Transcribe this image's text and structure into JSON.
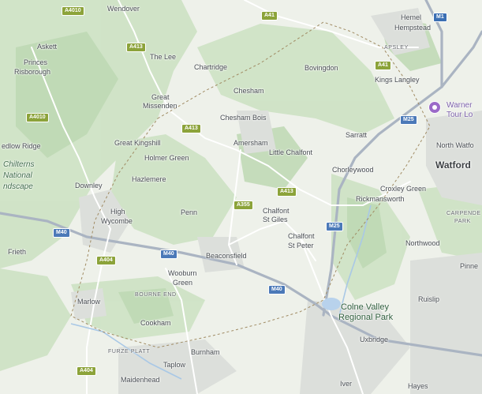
{
  "map": {
    "places": {
      "wendover": "Wendover",
      "hemel": "Hemel",
      "hempstead": "Hempstead",
      "apsley": "APSLEY",
      "askett": "Askett",
      "princes": "Princes",
      "risborough": "Risborough",
      "the_lee": "The Lee",
      "chartridge": "Chartridge",
      "bovingdon": "Bovingdon",
      "kings_langley": "Kings Langley",
      "warner_1": "Warner",
      "warner_2": "Tour Lo",
      "great": "Great",
      "missenden": "Missenden",
      "chesham": "Chesham",
      "sarratt": "Sarratt",
      "north_watford": "North Watfo",
      "edlow_ridge": "edlow Ridge",
      "chesham_bois": "Chesham Bois",
      "great_kingshill": "Great Kingshill",
      "amersham": "Amersham",
      "little_chalfont": "Little Chalfont",
      "watford": "Watford",
      "holmer_green": "Holmer Green",
      "chorleywood": "Chorleywood",
      "chilterns_1": "Chilterns",
      "chilterns_2": "National",
      "chilterns_3": "ndscape",
      "hazlemere": "Hazlemere",
      "downley": "Downley",
      "croxley_green": "Croxley Green",
      "rickmansworth": "Rickmansworth",
      "high": "High",
      "wycombe": "Wycombe",
      "penn": "Penn",
      "chalfont_sg_1": "Chalfont",
      "chalfont_sg_2": "St Giles",
      "carpenders_1": "CARPENDE",
      "carpenders_2": "PARK",
      "chalfont_sp_1": "Chalfont",
      "chalfont_sp_2": "St Peter",
      "frieth": "Frieth",
      "northwood": "Northwood",
      "beaconsfield": "Beaconsfield",
      "pinner": "Pinne",
      "wooburn": "Wooburn",
      "green": "Green",
      "marlow": "Marlow",
      "bourne_end": "BOURNE END",
      "colne_1": "Colne Valley",
      "colne_2": "Regional Park",
      "ruislip": "Ruislip",
      "cookham": "Cookham",
      "uxbridge": "Uxbridge",
      "furze_platt": "FURZE PLATT",
      "burnham": "Burnham",
      "taplow": "Taplow",
      "maidenhead": "Maidenhead",
      "iver": "Iver",
      "hayes": "Hayes"
    },
    "roads": {
      "a4010_top": "A4010",
      "a41_top": "A41",
      "m1": "M1",
      "a413_top": "A413",
      "a41_mid": "A41",
      "a4010_left": "A4010",
      "m25_right": "M25",
      "a413_mid": "A413",
      "a413_right": "A413",
      "a355": "A355",
      "m25_mid": "M25",
      "m40_left": "M40",
      "a404_mid": "A404",
      "m40_mid": "M40",
      "m40_low": "M40",
      "a404_bottom": "A404"
    },
    "icons": {
      "poi": "attraction-pin-icon"
    },
    "colors": {
      "base": "#e9ede6",
      "forest": "#c9e0c1",
      "urban": "#dadcd9",
      "motorway": "#b8c2cf",
      "a_road": "#ffffff",
      "boundary": "#9a8a6a",
      "a_shield": "#8ca33a",
      "m_shield": "#3b6fb3"
    }
  }
}
